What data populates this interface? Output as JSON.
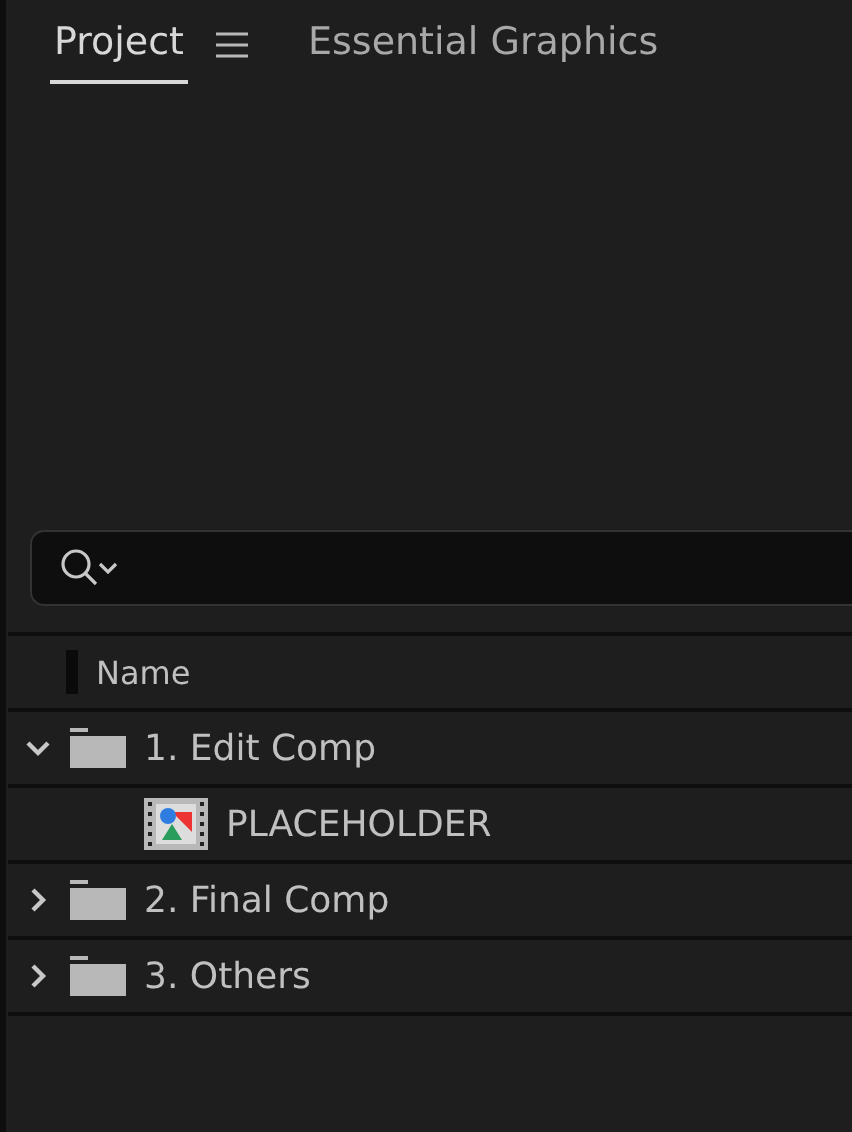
{
  "tabs": [
    {
      "label": "Project",
      "selected": true,
      "menu": true
    },
    {
      "label": "Essential Graphics",
      "selected": false,
      "menu": false
    }
  ],
  "search": {
    "kind": "search"
  },
  "columns": [
    "Name"
  ],
  "tree": [
    {
      "label": "1. Edit Comp",
      "kind": "folder",
      "expanded": true,
      "children": [
        {
          "label": "PLACEHOLDER",
          "kind": "composition"
        }
      ]
    },
    {
      "label": "2. Final Comp",
      "kind": "folder",
      "expanded": false
    },
    {
      "label": "3. Others",
      "kind": "folder",
      "expanded": false
    }
  ]
}
